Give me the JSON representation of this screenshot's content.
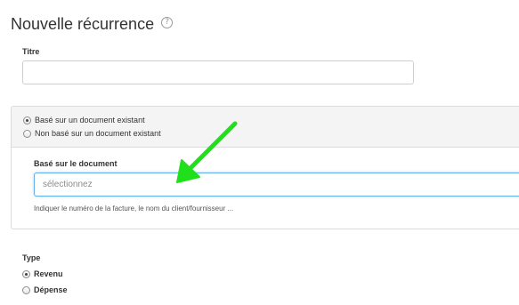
{
  "page": {
    "title": "Nouvelle récurrence",
    "help_icon": "question-circle-icon"
  },
  "title_field": {
    "label": "Titre",
    "value": "",
    "placeholder": ""
  },
  "source": {
    "options": [
      {
        "label": "Basé sur un document existant",
        "selected": true
      },
      {
        "label": "Non basé sur un document existant",
        "selected": false
      }
    ],
    "document_field": {
      "label": "Basé sur le document",
      "placeholder": "sélectionnez",
      "value": "",
      "help": "Indiquer le numéro de la facture, le nom du client/fournisseur ..."
    }
  },
  "type": {
    "label": "Type",
    "options": [
      {
        "label": "Revenu",
        "selected": true
      },
      {
        "label": "Dépense",
        "selected": false
      }
    ]
  },
  "annotation": {
    "icon": "arrow-icon",
    "color": "#1fe01b"
  },
  "colors": {
    "focus_border": "#66afe9"
  }
}
